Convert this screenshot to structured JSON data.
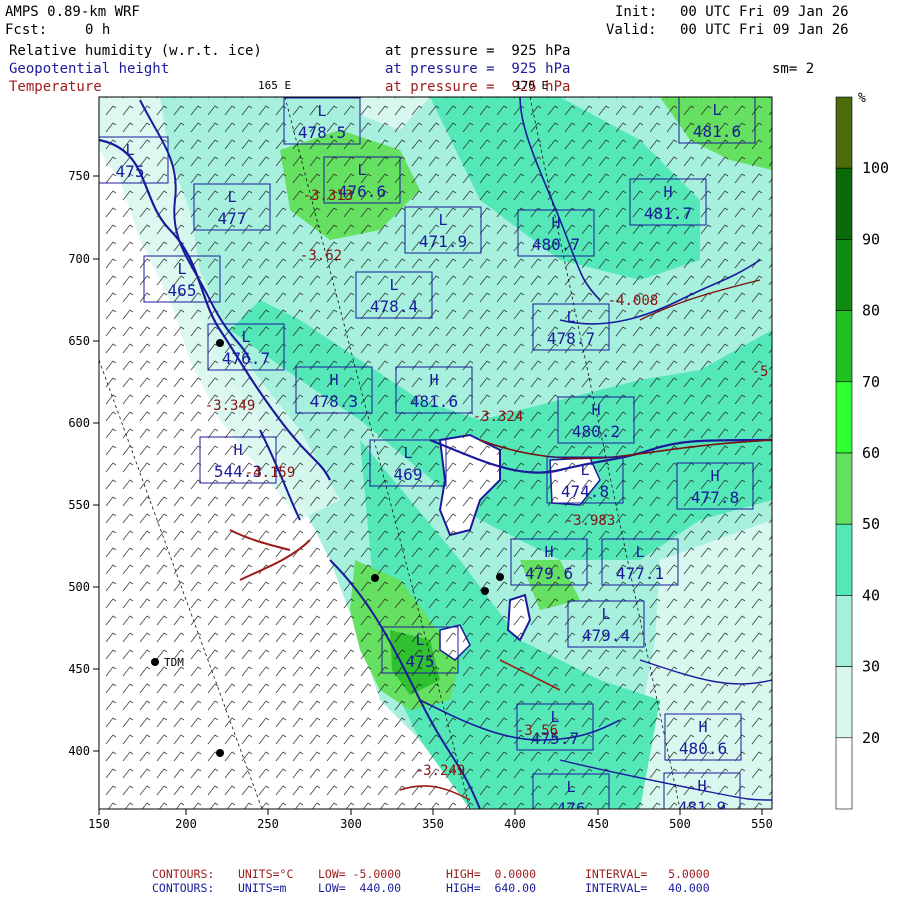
{
  "header": {
    "model": "AMPS 0.89-km WRF",
    "fcst_label": "Fcst:",
    "fcst_value": "0 h",
    "init_label": "Init:",
    "init_value": "00 UTC Fri 09 Jan 26",
    "valid_label": "Valid:",
    "valid_value": "00 UTC Fri 09 Jan 26",
    "field1": "Relative humidity (w.r.t. ice)",
    "field2": "Geopotential height",
    "field3": "Temperature",
    "pressure1": "at pressure =  925 hPa",
    "pressure2": "at pressure =  925 hPa",
    "pressure3": "at pressure =  925 hPa",
    "smoothing": "sm= 2",
    "lon_label_165": "165 E",
    "lon_label_170": "170 E"
  },
  "colorbar": {
    "unit": "%",
    "ticks": [
      "20",
      "30",
      "40",
      "50",
      "60",
      "70",
      "80",
      "90",
      "100"
    ],
    "colors": [
      "#ffffff",
      "#d8f7ee",
      "#a7f0dd",
      "#54e8b8",
      "#66e060",
      "#30ff30",
      "#21c021",
      "#118a11",
      "#0a6a0a",
      "#4c6b0a"
    ]
  },
  "axes": {
    "x_ticks": [
      "150",
      "200",
      "250",
      "300",
      "350",
      "400",
      "450",
      "500",
      "550"
    ],
    "y_ticks": [
      "750",
      "700",
      "650",
      "600",
      "550",
      "500",
      "450",
      "400"
    ]
  },
  "labels": {
    "H_markers": [
      {
        "letter": "H",
        "value": "481.7"
      },
      {
        "letter": "H",
        "value": "480.7"
      },
      {
        "letter": "H",
        "value": "478.3"
      },
      {
        "letter": "H",
        "value": "481.6"
      },
      {
        "letter": "H",
        "value": "480.2"
      },
      {
        "letter": "H",
        "value": "477.8"
      },
      {
        "letter": "H",
        "value": "479.6"
      },
      {
        "letter": "H",
        "value": "480.6"
      },
      {
        "letter": "H",
        "value": "544.3"
      },
      {
        "letter": "H",
        "value": "481.9"
      }
    ],
    "L_markers": [
      {
        "letter": "L",
        "value": "481.6"
      },
      {
        "letter": "L",
        "value": "478.5"
      },
      {
        "letter": "L",
        "value": "476.6"
      },
      {
        "letter": "L",
        "value": "477"
      },
      {
        "letter": "L",
        "value": "478.4"
      },
      {
        "letter": "L",
        "value": "478.7"
      },
      {
        "letter": "L",
        "value": "476.7"
      },
      {
        "letter": "L",
        "value": "469"
      },
      {
        "letter": "L",
        "value": "474.8"
      },
      {
        "letter": "L",
        "value": "477.1"
      },
      {
        "letter": "L",
        "value": "479.4"
      },
      {
        "letter": "L",
        "value": "475.7"
      },
      {
        "letter": "L",
        "value": "471.9"
      },
      {
        "letter": "L",
        "value": "475"
      },
      {
        "letter": "L",
        "value": "465"
      },
      {
        "letter": "L",
        "value": "476"
      },
      {
        "letter": "L",
        "value": "475"
      }
    ],
    "temperature_values": [
      "-3.313",
      "-3.62",
      "-4.008",
      "-3.324",
      "-3.349",
      "-3.983",
      "-3.249",
      "-4.159",
      "-3.56",
      "-5"
    ],
    "station": "TDM"
  },
  "footer": {
    "line1_label": "CONTOURS:",
    "line1_units": "UNITS=°C",
    "line1_low": "LOW= -5.0000",
    "line1_high": "HIGH=  0.0000",
    "line1_interval": "INTERVAL=   5.0000",
    "line2_label": "CONTOURS:",
    "line2_units": "UNITS=m",
    "line2_low": "LOW=  440.00",
    "line2_high": "HIGH=  640.00",
    "line2_interval": "INTERVAL=   40.000"
  }
}
